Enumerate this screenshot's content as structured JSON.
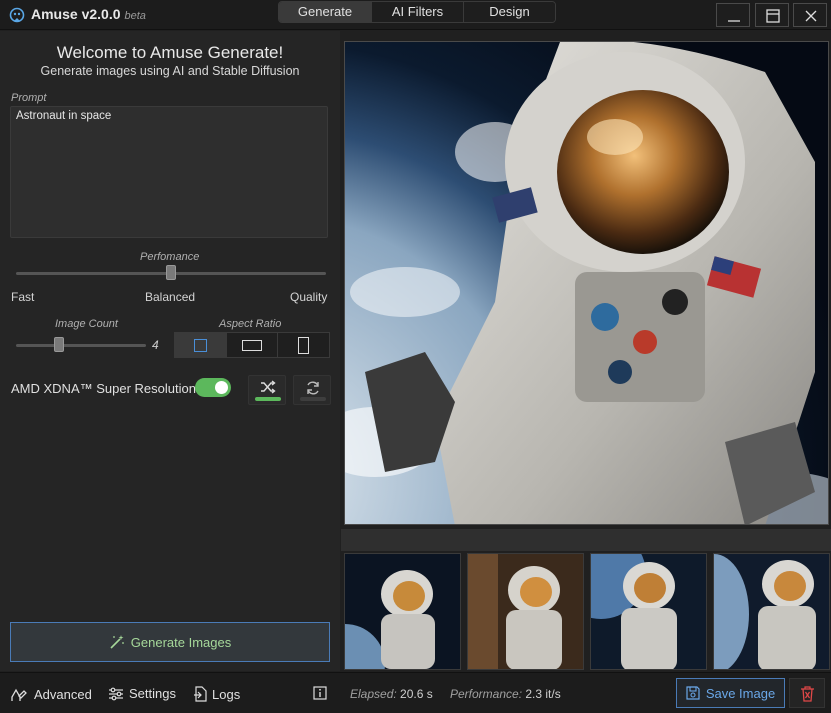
{
  "app": {
    "title": "Amuse v2.0.0",
    "beta": "beta"
  },
  "tabs": [
    {
      "label": "Generate"
    },
    {
      "label": "AI Filters"
    },
    {
      "label": "Design"
    }
  ],
  "window_controls": {
    "minimize": "minimize-icon",
    "maximize": "maximize-icon",
    "close": "close-icon"
  },
  "left": {
    "welcome": "Welcome to Amuse Generate!",
    "subtitle": "Generate images using AI and Stable Diffusion",
    "prompt_label": "Prompt",
    "prompt_value": "Astronaut in space",
    "performance": {
      "label": "Perfomance",
      "options": [
        "Fast",
        "Balanced",
        "Quality"
      ],
      "selected": "Balanced"
    },
    "image_count": {
      "label": "Image Count",
      "value": "4"
    },
    "aspect_ratio": {
      "label": "Aspect Ratio",
      "options": [
        "square",
        "landscape",
        "portrait"
      ],
      "selected": "square"
    },
    "super_resolution": {
      "label": "AMD XDNA™ Super Resolution",
      "enabled": true
    },
    "shuffle_button": {
      "icon": "shuffle-icon",
      "active": true
    },
    "refresh_button": {
      "icon": "refresh-icon",
      "active": false
    },
    "generate_button": {
      "label": "Generate Images",
      "icon": "magic-wand-icon"
    }
  },
  "main": {
    "image": "astronaut-in-space-image",
    "thumbnails": [
      "astronaut-thumbnail-1",
      "astronaut-thumbnail-2",
      "astronaut-thumbnail-3",
      "astronaut-thumbnail-4"
    ]
  },
  "statusbar": {
    "advanced": "Advanced",
    "settings": "Settings",
    "logs": "Logs",
    "elapsed_label": "Elapsed:",
    "elapsed_value": "20.6 s",
    "performance_label": "Performance:",
    "performance_value": "2.3 it/s",
    "save_label": "Save Image"
  },
  "colors": {
    "accent_blue": "#4a7bb7",
    "toggle_green": "#5cb85c",
    "generate_text": "#a6d89a",
    "delete_red": "#e04848"
  }
}
